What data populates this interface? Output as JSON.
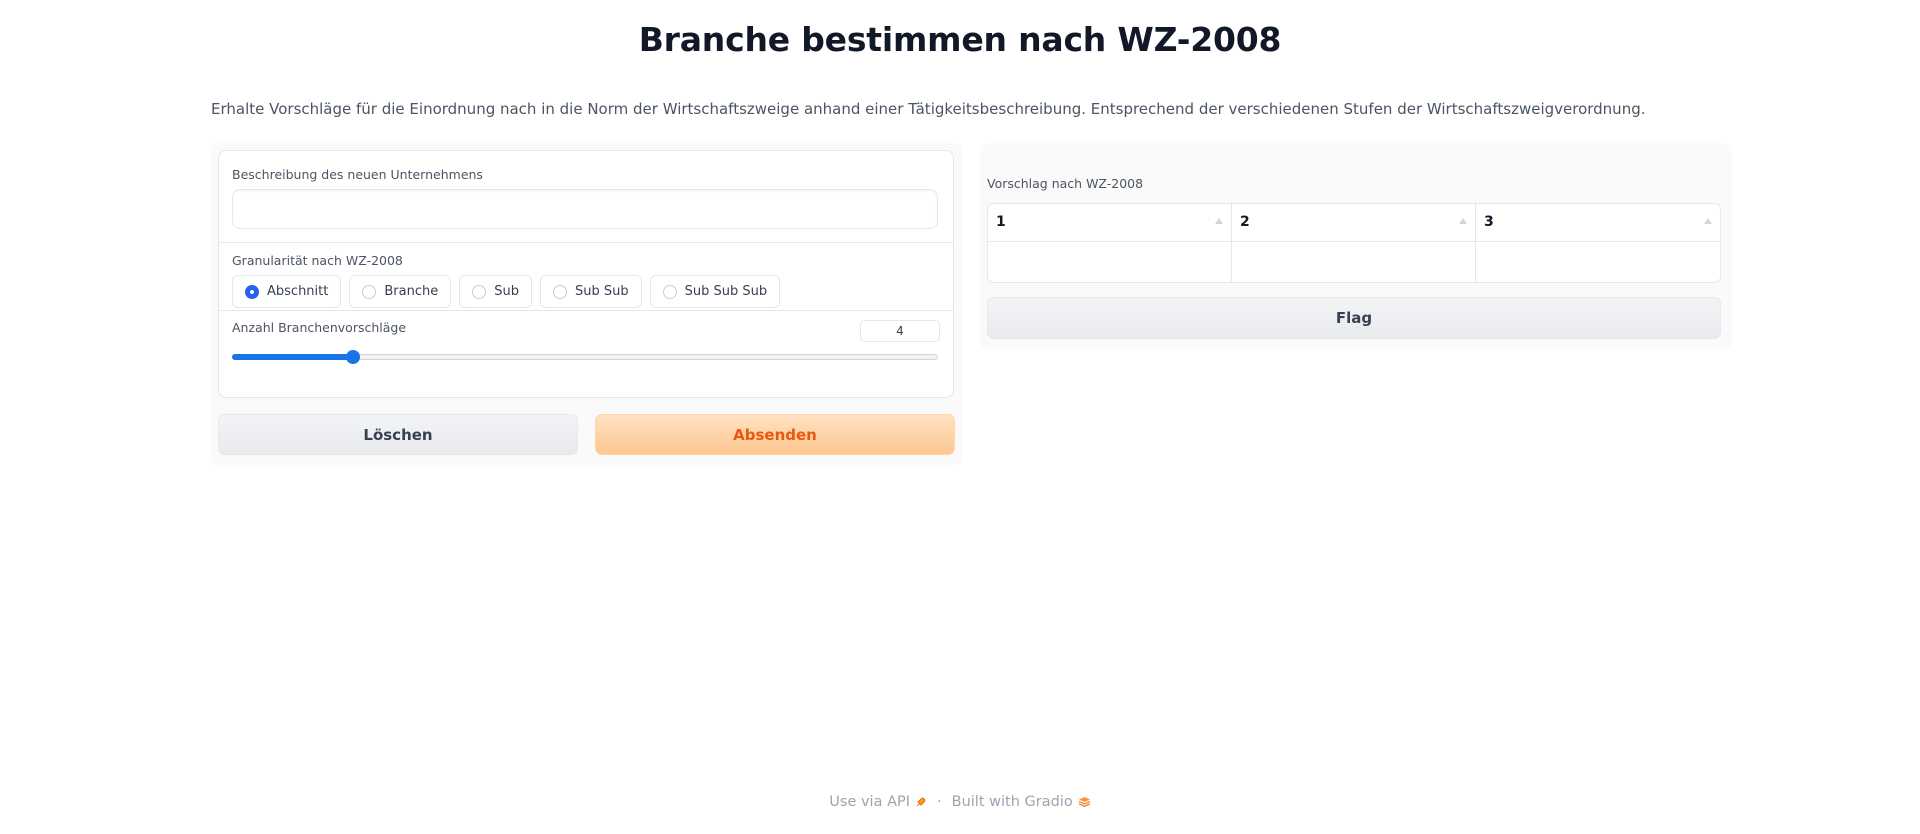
{
  "header": {
    "title": "Branche bestimmen nach WZ-2008",
    "description": "Erhalte Vorschläge für die Einordnung nach in die Norm der Wirtschaftszweige anhand einer Tätigkeitsbeschreibung. Entsprechend der verschiedenen Stufen der Wirtschaftszweigverordnung."
  },
  "form": {
    "description_label": "Beschreibung des neuen Unternehmens",
    "description_value": "",
    "granularity_label": "Granularität nach WZ-2008",
    "granularity_options": [
      "Abschnitt",
      "Branche",
      "Sub",
      "Sub Sub",
      "Sub Sub Sub"
    ],
    "granularity_selected": "Abschnitt",
    "count_label": "Anzahl Branchenvorschläge",
    "count_value": "4",
    "count_slider_fraction": 0.17,
    "clear_label": "Löschen",
    "submit_label": "Absenden"
  },
  "output": {
    "label": "Vorschlag nach WZ-2008",
    "columns": [
      "1",
      "2",
      "3"
    ],
    "rows": [
      [
        "",
        "",
        ""
      ]
    ],
    "flag_label": "Flag"
  },
  "footer": {
    "api_label": "Use via API",
    "separator": "·",
    "built_label": "Built with Gradio"
  },
  "colors": {
    "accent_blue": "#1a73e8",
    "primary_orange": "#ea580c"
  }
}
